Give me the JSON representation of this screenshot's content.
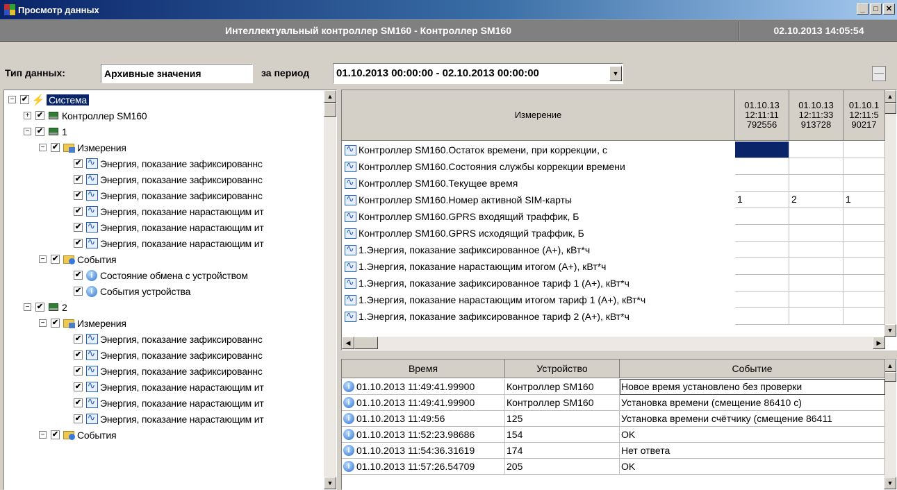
{
  "window": {
    "title": "Просмотр данных",
    "btn_min": "_",
    "btn_max": "□",
    "btn_close": "✕"
  },
  "header": {
    "controller_title": "Интеллектуальный контроллер SM160 - Контроллер SM160",
    "datetime": "02.10.2013 14:05:54"
  },
  "filter": {
    "type_label": "Тип данных:",
    "type_value": "Архивные значения",
    "period_label": "за период",
    "period_value": "01.10.2013 00:00:00 - 02.10.2013 00:00:00"
  },
  "tree": [
    {
      "label": "Система",
      "pm": "−",
      "icon": "lightning-icon"
    },
    {
      "label": "Контроллер SM160",
      "pm": "+",
      "icon": "device-icon"
    },
    {
      "label": "1",
      "pm": "−",
      "icon": "device-icon"
    },
    {
      "label": "Измерения",
      "pm": "−",
      "icon": "folder-chart-icon"
    },
    {
      "label": "Энергия, показание зафиксированнс",
      "icon": "waveform-icon"
    },
    {
      "label": "Энергия, показание зафиксированнс",
      "icon": "waveform-icon"
    },
    {
      "label": "Энергия, показание зафиксированнс",
      "icon": "waveform-icon"
    },
    {
      "label": "Энергия, показание нарастающим ит",
      "icon": "waveform-icon"
    },
    {
      "label": "Энергия, показание нарастающим ит",
      "icon": "waveform-icon"
    },
    {
      "label": "Энергия, показание нарастающим ит",
      "icon": "waveform-icon"
    },
    {
      "label": "События",
      "pm": "−",
      "icon": "folder-events-icon"
    },
    {
      "label": "Состояние обмена с устройством",
      "icon": "info-icon"
    },
    {
      "label": "События устройства",
      "icon": "info-icon"
    },
    {
      "label": "2",
      "pm": "−",
      "icon": "device-icon"
    },
    {
      "label": "Измерения",
      "pm": "−",
      "icon": "folder-chart-icon"
    },
    {
      "label": "Энергия, показание зафиксированнс",
      "icon": "waveform-icon"
    },
    {
      "label": "Энергия, показание зафиксированнс",
      "icon": "waveform-icon"
    },
    {
      "label": "Энергия, показание зафиксированнс",
      "icon": "waveform-icon"
    },
    {
      "label": "Энергия, показание нарастающим ит",
      "icon": "waveform-icon"
    },
    {
      "label": "Энергия, показание нарастающим ит",
      "icon": "waveform-icon"
    },
    {
      "label": "Энергия, показание нарастающим ит",
      "icon": "waveform-icon"
    },
    {
      "label": "События",
      "pm": "−",
      "icon": "folder-events-icon"
    }
  ],
  "measurements": {
    "header": "Измерение",
    "columns": [
      {
        "date": "01.10.13",
        "time": "12:11:11",
        "frac": "792556"
      },
      {
        "date": "01.10.13",
        "time": "12:11:33",
        "frac": "913728"
      },
      {
        "date": "01.10.1",
        "time": "12:11:5",
        "frac": "90217"
      }
    ],
    "rows": [
      {
        "name": "Контроллер SM160.Остаток времени, при коррекции, с",
        "v": [
          "",
          "",
          ""
        ]
      },
      {
        "name": "Контроллер SM160.Состояния службы коррекции времени",
        "v": [
          "",
          "",
          ""
        ]
      },
      {
        "name": "Контроллер SM160.Текущее время",
        "v": [
          "",
          "",
          ""
        ]
      },
      {
        "name": "Контроллер SM160.Номер активной SIM-карты",
        "v": [
          "1",
          "2",
          "1"
        ]
      },
      {
        "name": "Контроллер SM160.GPRS входящий траффик, Б",
        "v": [
          "",
          "",
          ""
        ]
      },
      {
        "name": "Контроллер SM160.GPRS исходящий траффик, Б",
        "v": [
          "",
          "",
          ""
        ]
      },
      {
        "name": "1.Энергия, показание зафиксированное (А+), кВт*ч",
        "v": [
          "",
          "",
          ""
        ]
      },
      {
        "name": "1.Энергия, показание нарастающим итогом (А+), кВт*ч",
        "v": [
          "",
          "",
          ""
        ]
      },
      {
        "name": "1.Энергия, показание зафиксированное тариф 1 (А+), кВт*ч",
        "v": [
          "",
          "",
          ""
        ]
      },
      {
        "name": "1.Энергия, показание нарастающим итогом тариф 1 (А+), кВт*ч",
        "v": [
          "",
          "",
          ""
        ]
      },
      {
        "name": "1.Энергия, показание зафиксированное тариф 2 (А+), кВт*ч",
        "v": [
          "",
          "",
          ""
        ]
      }
    ]
  },
  "events": {
    "headers": [
      "Время",
      "Устройство",
      "Событие"
    ],
    "rows": [
      {
        "time": "01.10.2013 11:49:41.99900",
        "device": "Контроллер SM160",
        "event": "Новое время установлено без проверки"
      },
      {
        "time": "01.10.2013 11:49:41.99900",
        "device": "Контроллер SM160",
        "event": "Установка времени (смещение 86410 с)"
      },
      {
        "time": "01.10.2013 11:49:56",
        "device": "125",
        "event": "Установка времени счётчику (смещение 86411"
      },
      {
        "time": "01.10.2013 11:52:23.98686",
        "device": "154",
        "event": "OK"
      },
      {
        "time": "01.10.2013 11:54:36.31619",
        "device": "174",
        "event": "Нет ответа"
      },
      {
        "time": "01.10.2013 11:57:26.54709",
        "device": "205",
        "event": "OK"
      }
    ]
  }
}
